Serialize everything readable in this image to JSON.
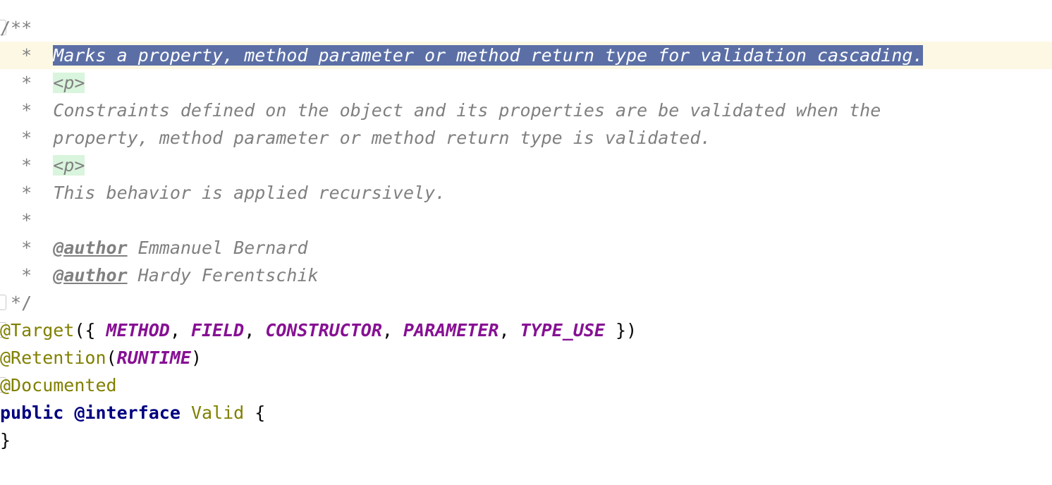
{
  "editor": {
    "background_color": "#ffffff",
    "selection_color": "#5b6fa6",
    "current_line_color": "#fdf8e3",
    "html_tag_highlight_color": "#d9f5dd",
    "comment_color": "#808080",
    "annotation_color": "#808000",
    "enum_constant_color": "#871094",
    "keyword_color": "#000080",
    "font_size_px": 25,
    "line_height_px": 39
  },
  "lines": [
    {
      "id": "line-1",
      "fold_marker": true,
      "current": false,
      "segments": [
        {
          "name": "comment-open-delimiter",
          "kind": "comment-delim",
          "text": "/**"
        }
      ]
    },
    {
      "id": "line-2",
      "fold_marker": false,
      "current": true,
      "segments": [
        {
          "name": "javadoc-star",
          "kind": "star",
          "text": "  *  "
        },
        {
          "name": "javadoc-summary-text",
          "kind": "comment-selected",
          "text": "Marks a property, method parameter or method return type for validation cascading."
        }
      ]
    },
    {
      "id": "line-3",
      "fold_marker": false,
      "current": false,
      "segments": [
        {
          "name": "javadoc-star",
          "kind": "star",
          "text": "  *  "
        },
        {
          "name": "javadoc-html-paragraph-tag",
          "kind": "tag",
          "text": "<p>"
        }
      ]
    },
    {
      "id": "line-4",
      "fold_marker": false,
      "current": false,
      "segments": [
        {
          "name": "javadoc-star",
          "kind": "star",
          "text": "  *  "
        },
        {
          "name": "javadoc-body-text",
          "kind": "comment",
          "text": "Constraints defined on the object and its properties are be validated when the"
        }
      ]
    },
    {
      "id": "line-5",
      "fold_marker": false,
      "current": false,
      "segments": [
        {
          "name": "javadoc-star",
          "kind": "star",
          "text": "  *  "
        },
        {
          "name": "javadoc-body-text",
          "kind": "comment",
          "text": "property, method parameter or method return type is validated."
        }
      ]
    },
    {
      "id": "line-6",
      "fold_marker": false,
      "current": false,
      "segments": [
        {
          "name": "javadoc-star",
          "kind": "star",
          "text": "  *  "
        },
        {
          "name": "javadoc-html-paragraph-tag",
          "kind": "tag",
          "text": "<p>"
        }
      ]
    },
    {
      "id": "line-7",
      "fold_marker": false,
      "current": false,
      "segments": [
        {
          "name": "javadoc-star",
          "kind": "star",
          "text": "  *  "
        },
        {
          "name": "javadoc-body-text",
          "kind": "comment",
          "text": "This behavior is applied recursively."
        }
      ]
    },
    {
      "id": "line-8",
      "fold_marker": false,
      "current": false,
      "segments": [
        {
          "name": "javadoc-star",
          "kind": "star",
          "text": "  *"
        }
      ]
    },
    {
      "id": "line-9",
      "fold_marker": false,
      "current": false,
      "segments": [
        {
          "name": "javadoc-star",
          "kind": "star",
          "text": "  *  "
        },
        {
          "name": "javadoc-author-tag",
          "kind": "doctag",
          "text": "@author"
        },
        {
          "name": "javadoc-author-name",
          "kind": "comment",
          "text": " Emmanuel Bernard"
        }
      ]
    },
    {
      "id": "line-10",
      "fold_marker": false,
      "current": false,
      "segments": [
        {
          "name": "javadoc-star",
          "kind": "star",
          "text": "  *  "
        },
        {
          "name": "javadoc-author-tag",
          "kind": "doctag",
          "text": "@author"
        },
        {
          "name": "javadoc-author-name",
          "kind": "comment",
          "text": " Hardy Ferentschik"
        }
      ]
    },
    {
      "id": "line-11",
      "fold_marker": true,
      "current": false,
      "segments": [
        {
          "name": "comment-close-delimiter",
          "kind": "comment-delim",
          "text": " */"
        }
      ]
    },
    {
      "id": "line-12",
      "fold_marker": true,
      "current": false,
      "segments": [
        {
          "name": "target-annotation",
          "kind": "annotation",
          "text": "@Target"
        },
        {
          "name": "punctuation",
          "kind": "punct",
          "text": "({ "
        },
        {
          "name": "enum-constant-method",
          "kind": "enum",
          "text": "METHOD"
        },
        {
          "name": "punctuation",
          "kind": "punct",
          "text": ", "
        },
        {
          "name": "enum-constant-field",
          "kind": "enum",
          "text": "FIELD"
        },
        {
          "name": "punctuation",
          "kind": "punct",
          "text": ", "
        },
        {
          "name": "enum-constant-constructor",
          "kind": "enum",
          "text": "CONSTRUCTOR"
        },
        {
          "name": "punctuation",
          "kind": "punct",
          "text": ", "
        },
        {
          "name": "enum-constant-parameter",
          "kind": "enum",
          "text": "PARAMETER"
        },
        {
          "name": "punctuation",
          "kind": "punct",
          "text": ", "
        },
        {
          "name": "enum-constant-type-use",
          "kind": "enum",
          "text": "TYPE_USE"
        },
        {
          "name": "punctuation",
          "kind": "punct",
          "text": " })"
        }
      ]
    },
    {
      "id": "line-13",
      "fold_marker": false,
      "current": false,
      "segments": [
        {
          "name": "retention-annotation",
          "kind": "annotation",
          "text": "@Retention"
        },
        {
          "name": "punctuation",
          "kind": "punct",
          "text": "("
        },
        {
          "name": "enum-constant-runtime",
          "kind": "enum",
          "text": "RUNTIME"
        },
        {
          "name": "punctuation",
          "kind": "punct",
          "text": ")"
        }
      ]
    },
    {
      "id": "line-14",
      "fold_marker": true,
      "current": false,
      "segments": [
        {
          "name": "documented-annotation",
          "kind": "annotation",
          "text": "@Documented"
        }
      ]
    },
    {
      "id": "line-15",
      "fold_marker": false,
      "current": false,
      "segments": [
        {
          "name": "keyword-public",
          "kind": "keyword",
          "text": "public"
        },
        {
          "name": "punctuation",
          "kind": "punct",
          "text": " "
        },
        {
          "name": "keyword-at-interface",
          "kind": "keyword",
          "text": "@interface"
        },
        {
          "name": "punctuation",
          "kind": "punct",
          "text": " "
        },
        {
          "name": "type-name-valid",
          "kind": "type",
          "text": "Valid"
        },
        {
          "name": "punctuation",
          "kind": "punct",
          "text": " {"
        }
      ]
    },
    {
      "id": "line-16",
      "fold_marker": false,
      "current": false,
      "segments": [
        {
          "name": "closing-brace",
          "kind": "punct",
          "text": "}"
        }
      ]
    }
  ]
}
